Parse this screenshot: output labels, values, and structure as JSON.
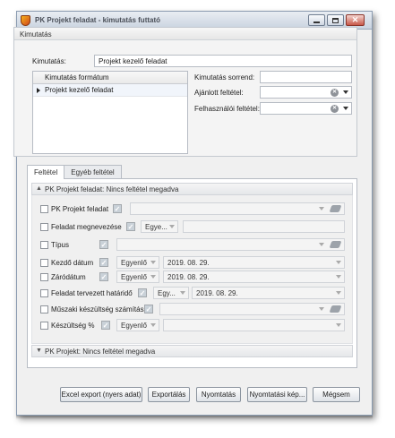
{
  "window": {
    "title": "PK Projekt feladat - kimutatás futtató"
  },
  "report_group": {
    "caption": "Kimutatás",
    "report_label": "Kimutatás:",
    "report_value": "Projekt kezelő feladat",
    "format_grid": {
      "column_header": "Kimutatás formátum",
      "rows": [
        "Projekt kezelő feladat"
      ]
    },
    "order_label": "Kimutatás sorrend:",
    "order_value": "",
    "suggested_filter_label": "Ajánlott feltétel:",
    "suggested_filter_value": "",
    "user_filter_label": "Felhasználói feltétel:",
    "user_filter_value": ""
  },
  "tabs": [
    {
      "label": "Feltétel",
      "active": true
    },
    {
      "label": "Egyéb feltétel",
      "active": false
    }
  ],
  "condition_section": {
    "header": "PK Projekt feladat: Nincs feltétel megadva",
    "rows": [
      {
        "label": "PK Projekt feladat",
        "operator": "",
        "value": ""
      },
      {
        "label": "Feladat megnevezése",
        "operator": "Egye...",
        "value": ""
      },
      {
        "label": "Típus",
        "operator": "",
        "value": ""
      },
      {
        "label": "Kezdő dátum",
        "operator": "Egyenlő",
        "value": "2019. 08. 29."
      },
      {
        "label": "Záródátum",
        "operator": "Egyenlő",
        "value": "2019. 08. 29."
      },
      {
        "label": "Feladat tervezett határidő",
        "operator": "Egy...",
        "value": "2019. 08. 29."
      },
      {
        "label": "Műszaki készültség számítás",
        "operator": "",
        "value": ""
      },
      {
        "label": "Készültség %",
        "operator": "Egyenlő",
        "value": ""
      }
    ]
  },
  "second_section": {
    "header": "PK Projekt: Nincs feltétel megadva"
  },
  "buttons": {
    "excel_export": "Excel export (nyers adat)",
    "export": "Exportálás",
    "print": "Nyomtatás",
    "print_preview": "Nyomtatási kép...",
    "cancel": "Mégsem"
  }
}
